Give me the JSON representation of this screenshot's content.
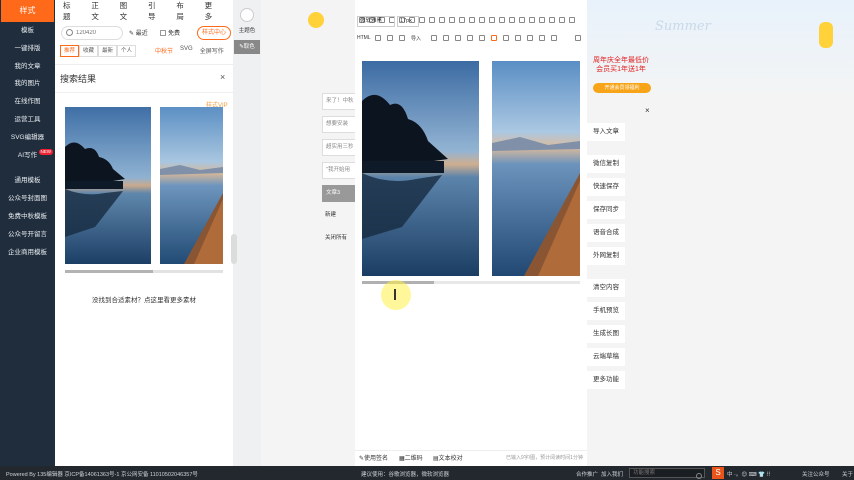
{
  "leftnav": {
    "brand": "样式",
    "items": [
      "模板",
      "一键排版",
      "我的文章",
      "我的图片",
      "在线作图",
      "运营工具",
      "SVG编辑器",
      "AI写作"
    ],
    "ai_badge": "NEW",
    "extra_items": [
      "通用模板",
      "公众号封面图",
      "免费中秋模板",
      "公众号开留言",
      "企业商用模板"
    ]
  },
  "material": {
    "categories": [
      "标题",
      "正文",
      "图文",
      "引导",
      "布局",
      "更多"
    ],
    "search": {
      "value": "",
      "placeholder": "120420"
    },
    "recent": "最近",
    "free": "免费",
    "style_center": "样式中心",
    "sorts": [
      "推荐",
      "收藏",
      "最新",
      "个人"
    ],
    "active_sort": "推荐",
    "types": [
      "中秋节",
      "SVG",
      "全屏写作"
    ],
    "active_type": "中秋节",
    "result_title": "搜索结果",
    "close": "×",
    "vip": "样式VIP",
    "no_match": "没找到合适素材？点这里看更多素材",
    "scroll_fraction": 0.56
  },
  "colorpanel": {
    "theme_color": "主题色",
    "pick_color": "取色"
  },
  "drafts": [
    "来了！中秋",
    "想要安装",
    "超实用三秒",
    "\"我开始用",
    "文章3",
    "新建",
    "关闭所有"
  ],
  "editor": {
    "font_family": "微软雅黑",
    "font_size": "17px",
    "html_label": "HTML",
    "import_label": "导入",
    "statusbar": {
      "signature": "使用签名",
      "qrcode": "二维码",
      "proofread": "文本校对",
      "count": "已输入9字/图，预计阅读时间1分钟"
    },
    "scroll_fraction": 0.33
  },
  "rightside": {
    "banner_word": "Summer",
    "promo": [
      "周年庆全年最低价",
      "会员买1年送1年"
    ],
    "promo_btn": "开通会员领福利",
    "close": "×",
    "actions": [
      "导入文章",
      "微信复制",
      "快速保存",
      "保存同步",
      "语音合成",
      "外网复制",
      "清空内容",
      "手机预览",
      "生成长图",
      "云端草稿",
      "更多功能"
    ]
  },
  "footer": {
    "left": "Powered By 135编辑器  京ICP备14061363号-1  京公网安备 11010502046357号",
    "tip": "建议使用：谷歌浏览器，微软浏览器",
    "cooperation": "合作推广",
    "join": "加入我们",
    "search_placeholder": "功能搜索",
    "ime": "S",
    "ime_text": "中 ·。😊 ⌨ 👕 ⠿",
    "official": "关注公众号",
    "more": "关于"
  },
  "colors": {
    "accent": "#ff6a1a",
    "nav_bg": "#1f2d3d",
    "footer_bg": "#23272e"
  }
}
